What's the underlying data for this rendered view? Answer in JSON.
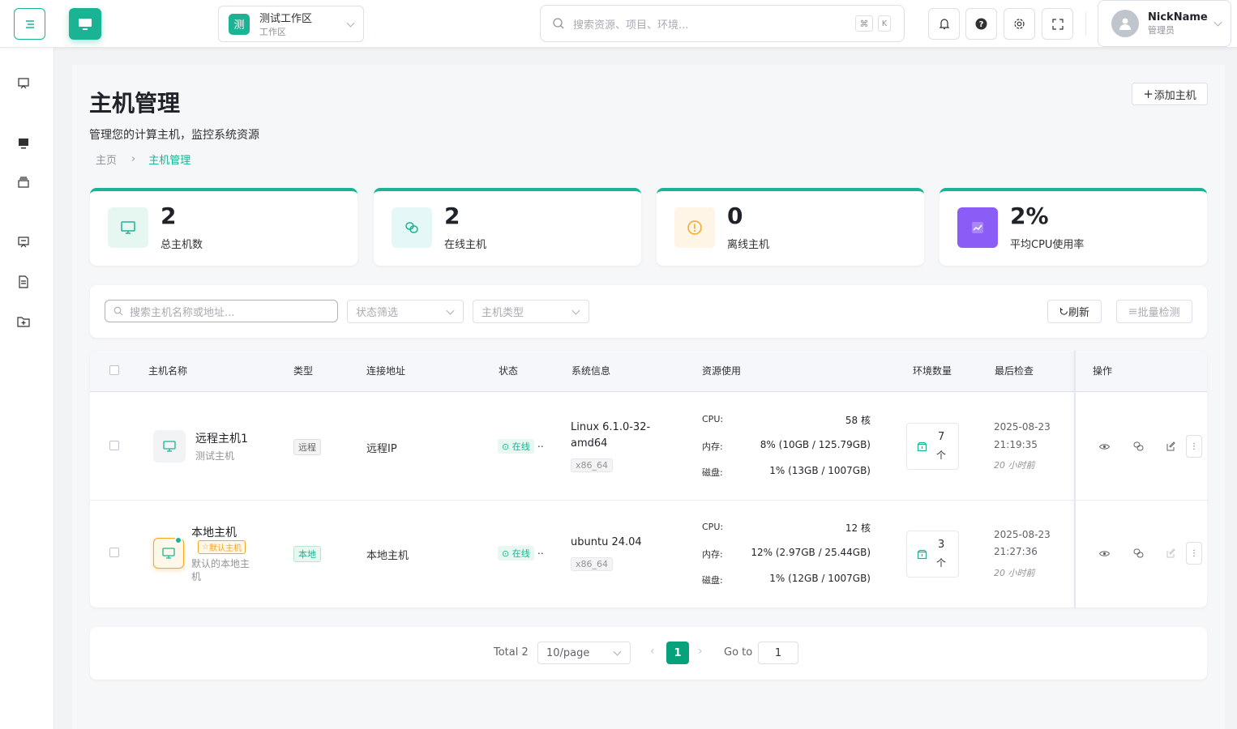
{
  "colors": {
    "primary": "#1ab394",
    "brand_dark": "#07a27b",
    "warning": "#f5a623",
    "purple": "#8b5cf6"
  },
  "header": {
    "workspace_badge": "测",
    "workspace_name": "测试工作区",
    "workspace_sub": "工作区",
    "search_placeholder": "搜索资源、项目、环境...",
    "kbd_cmd": "⌘",
    "kbd_k": "K",
    "user_name": "NickName",
    "user_role": "管理员"
  },
  "page": {
    "title": "主机管理",
    "subtitle": "管理您的计算主机，监控系统资源",
    "add_button": "添加主机",
    "breadcrumb": [
      "主页",
      "主机管理"
    ]
  },
  "stats": [
    {
      "value": "2",
      "label": "总主机数",
      "icon": "monitor-icon"
    },
    {
      "value": "2",
      "label": "在线主机",
      "icon": "link-icon"
    },
    {
      "value": "0",
      "label": "离线主机",
      "icon": "alert-icon"
    },
    {
      "value": "2%",
      "label": "平均CPU使用率",
      "icon": "trend-icon"
    }
  ],
  "filters": {
    "search_placeholder": "搜索主机名称或地址...",
    "status_placeholder": "状态筛选",
    "type_placeholder": "主机类型",
    "refresh_label": "刷新",
    "batch_label": "批量检测"
  },
  "table": {
    "headers": [
      "主机名称",
      "类型",
      "连接地址",
      "状态",
      "系统信息",
      "资源使用",
      "环境数量",
      "最后检查",
      "操作"
    ],
    "resource_labels": [
      "CPU:",
      "内存:",
      "磁盘:"
    ],
    "rows": [
      {
        "name": "远程主机1",
        "desc": "测试主机",
        "type": "远程",
        "address": "远程IP",
        "status": "在线",
        "os": "Linux 6.1.0-32-amd64",
        "arch": "x86_64",
        "cpu": "58 核",
        "mem": "8% (10GB / 125.79GB)",
        "disk": "1% (13GB / 1007GB)",
        "env_count": "7",
        "env_unit": "个",
        "check_date": "2025-08-23",
        "check_time": "21:19:35",
        "check_ago": "20 小时前"
      },
      {
        "name": "本地主机",
        "badge": "默认主机",
        "desc": "默认的本地主机",
        "type": "本地",
        "address": "本地主机",
        "status": "在线",
        "os": "ubuntu 24.04",
        "arch": "x86_64",
        "cpu": "12 核",
        "mem": "12% (2.97GB / 25.44GB)",
        "disk": "1% (12GB / 1007GB)",
        "env_count": "3",
        "env_unit": "个",
        "check_date": "2025-08-23",
        "check_time": "21:27:36",
        "check_ago": "20 小时前"
      }
    ]
  },
  "pagination": {
    "total": "Total 2",
    "page_size": "10/page",
    "current": "1",
    "goto_label": "Go to",
    "goto_value": "1"
  }
}
